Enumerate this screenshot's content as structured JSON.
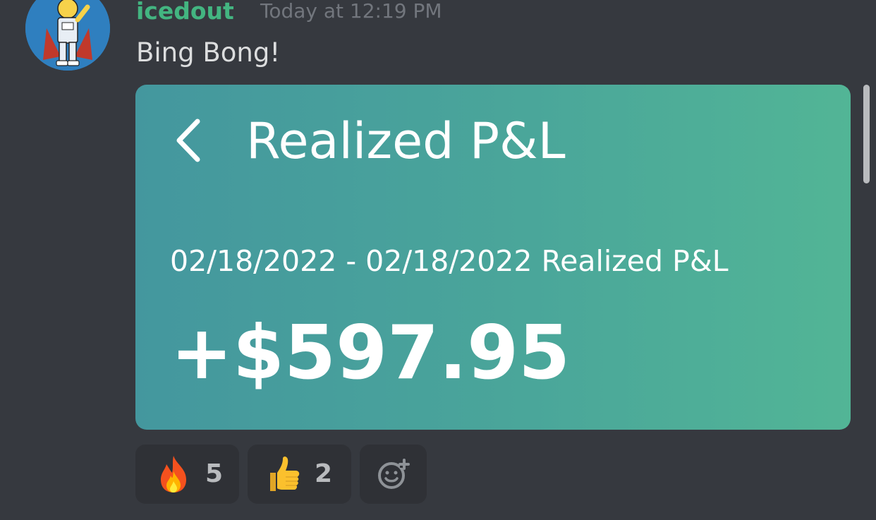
{
  "message": {
    "author": "icedout",
    "timestamp": "Today at 12:19 PM",
    "text": "Bing Bong!"
  },
  "attachment": {
    "title": "Realized P&L",
    "date_range": "02/18/2022 - 02/18/2022 Realized P&L",
    "amount": "+$597.95"
  },
  "reactions": [
    {
      "emoji": "fire-emoji",
      "count": "5"
    },
    {
      "emoji": "thumbs-up-emoji",
      "count": "2"
    }
  ],
  "colors": {
    "background": "#36393f",
    "username": "#43b581",
    "card_gradient_start": "#44979e",
    "card_gradient_end": "#52b596"
  }
}
